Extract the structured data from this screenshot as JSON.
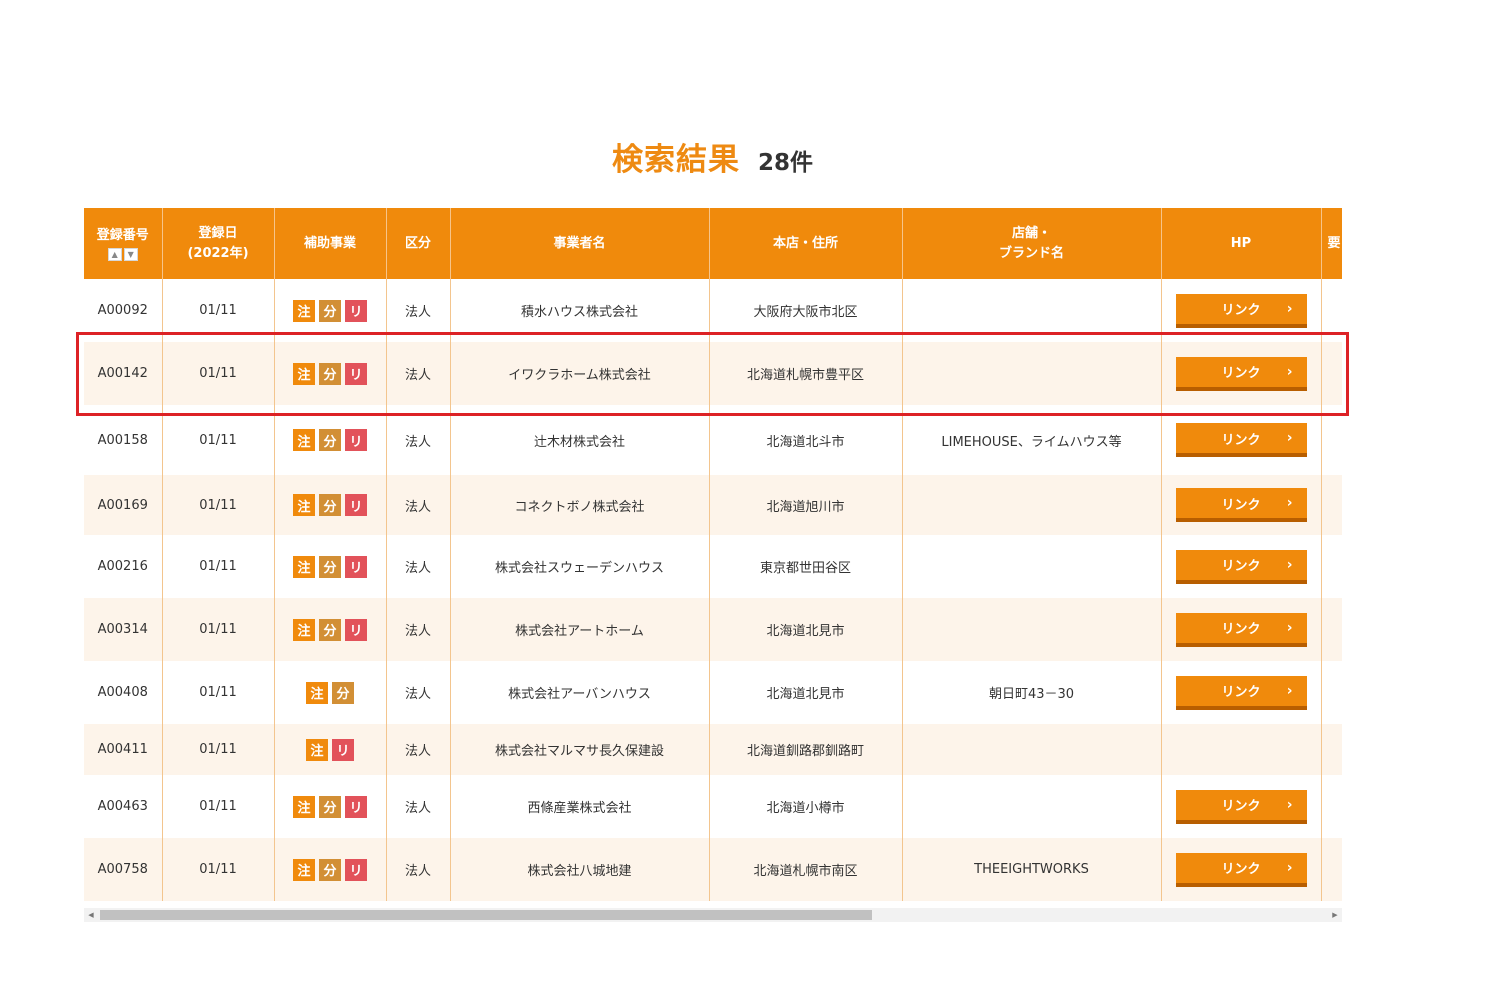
{
  "heading": {
    "title": "検索結果",
    "count": "28件"
  },
  "colors": {
    "accent": "#f08a0c",
    "badge_chu": "#f08a0c",
    "badge_bun": "#d28f35",
    "badge_ri": "#e2525a",
    "highlight": "#dd2226"
  },
  "table": {
    "headers": {
      "reg_no": "登録番号",
      "reg_date_1": "登録日",
      "reg_date_2": "(2022年)",
      "subsidy": "補助事業",
      "category": "区分",
      "company": "事業者名",
      "address": "本店・住所",
      "brand_1": "店舗・",
      "brand_2": "ブランド名",
      "hp": "HP",
      "extra": "要"
    },
    "badge_labels": {
      "chu": "注",
      "bun": "分",
      "ri": "リ"
    },
    "link_label": "リンク",
    "rows": [
      {
        "no": "A00092",
        "date": "01/11",
        "category": "法人",
        "company": "積水ハウス株式会社",
        "address": "大阪府大阪市北区",
        "brand": ""
      },
      {
        "no": "A00142",
        "date": "01/11",
        "category": "法人",
        "company": "イワクラホーム株式会社",
        "address": "北海道札幌市豊平区",
        "brand": ""
      },
      {
        "no": "A00158",
        "date": "01/11",
        "category": "法人",
        "company": "辻木材株式会社",
        "address": "北海道北斗市",
        "brand": "LIMEHOUSE、ライムハウス等"
      },
      {
        "no": "A00169",
        "date": "01/11",
        "category": "法人",
        "company": "コネクトボノ株式会社",
        "address": "北海道旭川市",
        "brand": ""
      },
      {
        "no": "A00216",
        "date": "01/11",
        "category": "法人",
        "company": "株式会社スウェーデンハウス",
        "address": "東京都世田谷区",
        "brand": ""
      },
      {
        "no": "A00314",
        "date": "01/11",
        "category": "法人",
        "company": "株式会社アートホーム",
        "address": "北海道北見市",
        "brand": ""
      },
      {
        "no": "A00408",
        "date": "01/11",
        "category": "法人",
        "company": "株式会社アーバンハウス",
        "address": "北海道北見市",
        "brand": "朝日町43－30"
      },
      {
        "no": "A00411",
        "date": "01/11",
        "category": "法人",
        "company": "株式会社マルマサ長久保建設",
        "address": "北海道釧路郡釧路町",
        "brand": ""
      },
      {
        "no": "A00463",
        "date": "01/11",
        "category": "法人",
        "company": "西條産業株式会社",
        "address": "北海道小樽市",
        "brand": ""
      },
      {
        "no": "A00758",
        "date": "01/11",
        "category": "法人",
        "company": "株式会社八城地建",
        "address": "北海道札幌市南区",
        "brand": "THEEIGHTWORKS"
      }
    ]
  }
}
